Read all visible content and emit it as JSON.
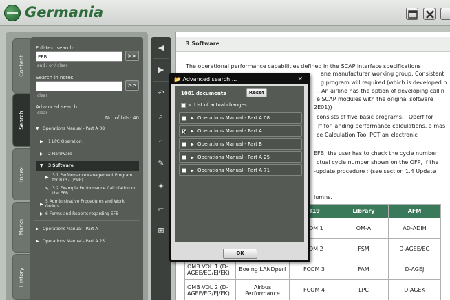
{
  "app": {
    "title": "Germania"
  },
  "colors": {
    "brand": "#2e6b3a",
    "table_header": "#3a7a5a",
    "panel": "#575c57",
    "modal_title": "#0e0f0e"
  },
  "side_tabs": [
    "Content",
    "Search",
    "Index",
    "Marks",
    "History"
  ],
  "search": {
    "fulltext_label": "Full-text search:",
    "fulltext_value": "EFB",
    "fulltext_go": ">>",
    "operators": "and  /  or  /  clear",
    "notes_label": "Search in notes:",
    "notes_value": "",
    "notes_go": ">>",
    "notes_clear": "clear",
    "advanced_label": "Advanced search",
    "advanced_clear": "clear",
    "hits_label": "No. of hits: 40",
    "tree": [
      "Operations Manual - Part A 08",
      "1 LPC Operation",
      "2 Hardware",
      "3 Software",
      "3.1 PerformanceManagement Program for B737 (PMP)",
      "3.2 Example Performance Calculation on the EFB",
      "5 Administrative Procedures and Work Orders",
      "6 Forms and Reports regarding EFB",
      "Operations Manual - Part A",
      "Operations Manual - Part A 25"
    ]
  },
  "toolbar": {
    "icons": [
      "arrow-left-icon",
      "arrow-right-icon",
      "undo-icon",
      "zoom-in-icon",
      "zoom-out-icon",
      "pen-icon",
      "pin-icon",
      "crop-icon",
      "split-icon"
    ]
  },
  "document": {
    "heading": "3 Software",
    "para1": [
      "The operational performance capabilities defined in the SCAP interface specifications",
      "ane manufacturer working group. Consistent",
      "g program will required (which is developed b",
      ". An airline has the option of developing callin",
      "e SCAP modules with the original software",
      "2E01))"
    ],
    "para2": [
      "consists of five basic programs, TOperf for",
      "rf for landing performance calculations, a mas",
      "ce Calculation Tool PCT an electronic"
    ],
    "para3": [
      "EFB, the user has to check the cycle number",
      "ctual cycle number shown on the OFP, if the",
      "-update procedure : (see section 1.4 Update"
    ],
    "para4": "lumns.",
    "table": {
      "headers": [
        "",
        "",
        "319",
        "Library",
        "AFM"
      ],
      "rows": [
        [
          "",
          "",
          "COM 1",
          "OM-A",
          "AD-ADIH"
        ],
        [
          "",
          "",
          "COM 2",
          "FSM",
          "D-AGEE/EG"
        ],
        [
          "OMB VOL 1 (D-AGEE/EG/EJ/EK)",
          "Boeing LANDperf",
          "FCOM 3",
          "FAM",
          "D-AGEJ"
        ],
        [
          "OMB VOL 2 (D-AGEE/EG/EJ/EK)",
          "Airbus Performance",
          "FCOM 4",
          "LPC",
          "D-AGEK"
        ]
      ]
    }
  },
  "modal": {
    "title": "Advanced search ...",
    "close": "×",
    "count": "1081 documents",
    "reset": "Reset",
    "list_label": "List of actual changes",
    "items": [
      {
        "label": "Operations Manual - Part A 08",
        "checked": false
      },
      {
        "label": "Operations Manual - Part A",
        "checked": true
      },
      {
        "label": "Operations Manual - Part B",
        "checked": false
      },
      {
        "label": "Operations Manual - Part A 25",
        "checked": false
      },
      {
        "label": "Operations Manual - Part A 71",
        "checked": false
      }
    ],
    "ok": "OK"
  }
}
